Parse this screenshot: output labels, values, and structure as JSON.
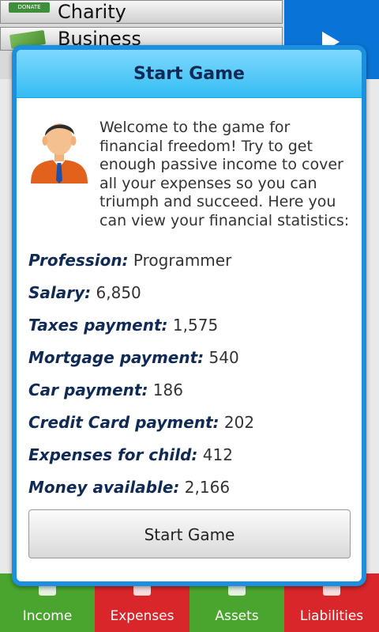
{
  "background": {
    "list_items": [
      {
        "label": "Charity",
        "icon": "donate-badge",
        "badge_text": "DONATE"
      },
      {
        "label": "Business",
        "icon": "money-bills-icon"
      }
    ],
    "right_panel_icon": "play-arrow-icon"
  },
  "dialog": {
    "title": "Start Game",
    "intro": "Welcome to the game for financial freedom! Try to get enough passive income to cover all your expenses so you can triumph and succeed. Here you can view your financial statistics:",
    "avatar_icon": "businessman-avatar",
    "stats": [
      {
        "label": "Profession:",
        "value": "Programmer"
      },
      {
        "label": "Salary:",
        "value": "6,850"
      },
      {
        "label": "Taxes payment:",
        "value": "1,575"
      },
      {
        "label": "Mortgage payment:",
        "value": "540"
      },
      {
        "label": "Car payment:",
        "value": "186"
      },
      {
        "label": "Credit Card payment:",
        "value": "202"
      },
      {
        "label": "Expenses for child:",
        "value": "412"
      },
      {
        "label": "Money available:",
        "value": "2,166"
      }
    ],
    "start_button": "Start Game"
  },
  "tabs": [
    {
      "label": "Income",
      "color": "#4aa52e"
    },
    {
      "label": "Expenses",
      "color": "#d8262a"
    },
    {
      "label": "Assets",
      "color": "#4aa52e"
    },
    {
      "label": "Liabilities",
      "color": "#d8262a"
    }
  ],
  "colors": {
    "dialog_border": "#1b8fe0",
    "header_bg": "#33bdf2",
    "label_text": "#0e2a55"
  }
}
